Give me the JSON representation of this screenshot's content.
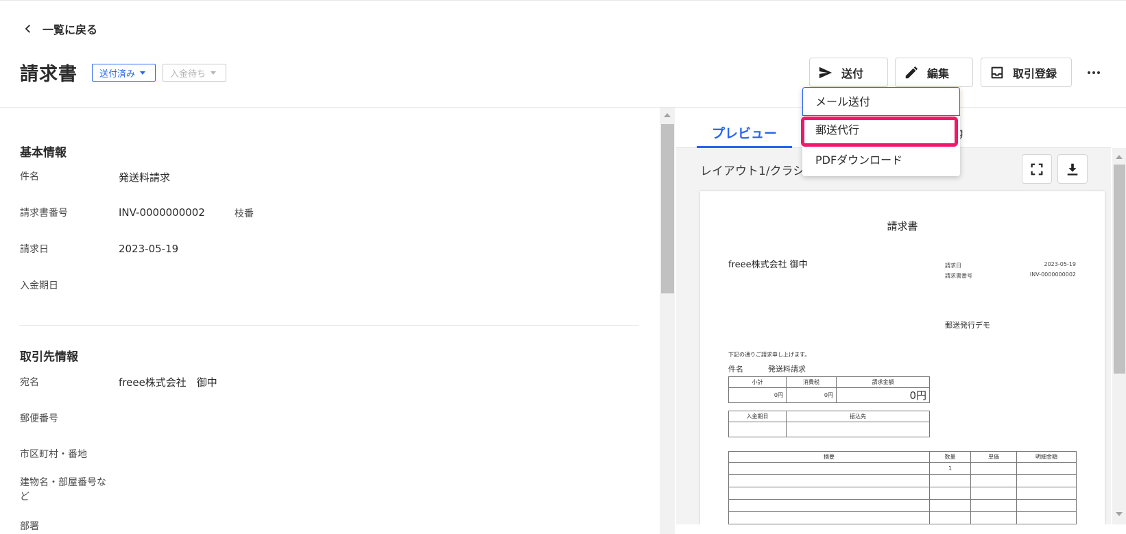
{
  "nav": {
    "back_label": "一覧に戻る"
  },
  "header": {
    "title": "請求書",
    "status_sent": "送付済み",
    "status_payment": "入金待ち",
    "send_label": "送付",
    "edit_label": "編集",
    "deal_label": "取引登録"
  },
  "send_menu": {
    "items": [
      "メール送付",
      "郵送代行",
      "PDFダウンロード"
    ],
    "highlight_color": "#f0176d"
  },
  "basic_info": {
    "title": "基本情報",
    "subject_label": "件名",
    "subject_value": "発送料請求",
    "invoice_no_label": "請求書番号",
    "invoice_no_value": "INV-0000000002",
    "branch_label": "枝番",
    "date_label": "請求日",
    "date_value": "2023-05-19",
    "due_label": "入金期日"
  },
  "partner_info": {
    "title": "取引先情報",
    "name_label": "宛名",
    "name_value": "freee株式会社　御中",
    "zip_label": "郵便番号",
    "city_label": "市区町村・番地",
    "building_label": "建物名・部屋番号など",
    "dept_label": "部署"
  },
  "preview": {
    "tab_preview": "プレビュー",
    "tab_other_partial": "g",
    "layout_label": "レイアウト1/クラシ"
  },
  "document": {
    "title": "請求書",
    "recipient": "freee株式会社 御中",
    "date_label": "請求日",
    "date_value": "2023-05-19",
    "number_label": "請求書番号",
    "number_value": "INV-0000000002",
    "sender": "郵送発行デモ",
    "intro": "下記の通りご請求申し上げます。",
    "subject_label": "件名",
    "subject_value": "発送料請求",
    "totals": {
      "headers": [
        "小計",
        "消費税",
        "請求金額"
      ],
      "values": [
        "0円",
        "0円",
        "0円"
      ]
    },
    "payment_headers": [
      "入金期日",
      "振込先"
    ],
    "items": {
      "headers": [
        "摘要",
        "数量",
        "単価",
        "明細金額"
      ],
      "first_qty": "1"
    }
  },
  "colors": {
    "accent": "#2864f0",
    "highlight": "#f0176d"
  }
}
